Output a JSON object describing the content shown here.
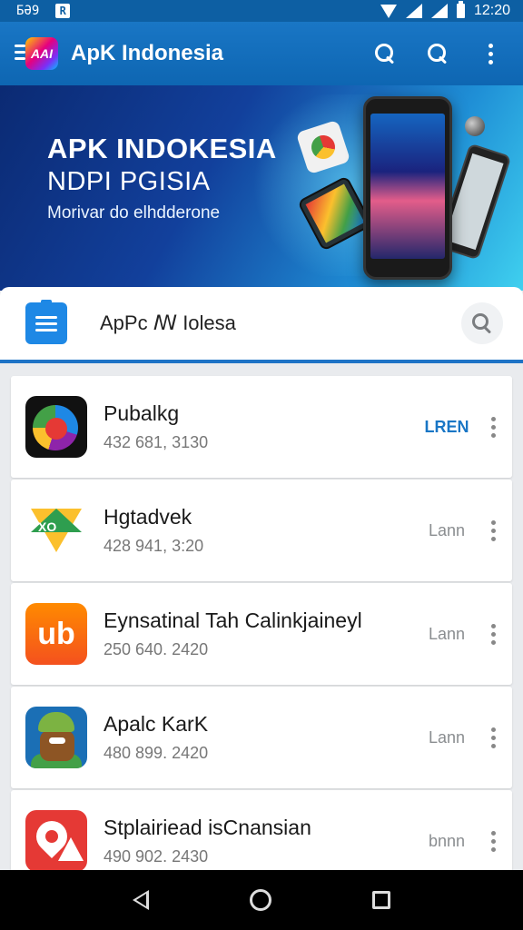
{
  "statusbar": {
    "left_text": "БӘ9",
    "left_box": "R",
    "time": "12:20"
  },
  "appbar": {
    "logo_text": "AAI",
    "title": "ApK Indonesia"
  },
  "banner": {
    "headline": "APK INDOKESIA",
    "subheadline": "NDPI PGISIA",
    "tagline": "Morivar do elhdderone"
  },
  "search": {
    "query": "ApPc ꟿ Iolesa"
  },
  "apps": [
    {
      "name": "Pubalkg",
      "meta": "432 681, 3130",
      "action": "LREN",
      "icon_text": ""
    },
    {
      "name": "Hgtadvek",
      "meta": "428 941, 3:20",
      "action": "Lann",
      "icon_text": "XO"
    },
    {
      "name": "Eynsatinal Tah Calinkjaineyl",
      "meta": "250 640. 2420",
      "action": "Lann",
      "icon_text": "ub"
    },
    {
      "name": "Apalc KarK",
      "meta": "480 899. 2420",
      "action": "Lann",
      "icon_text": ""
    },
    {
      "name": "Stplairiead isCnansian",
      "meta": "490 902. 2430",
      "action": "bnnn",
      "icon_text": ""
    }
  ],
  "colors": {
    "primary": "#1976c5",
    "status": "#0d5fa3"
  },
  "icons": [
    "menu-icon",
    "search-icon",
    "more-vert-icon",
    "back-icon",
    "home-icon",
    "recents-icon"
  ]
}
